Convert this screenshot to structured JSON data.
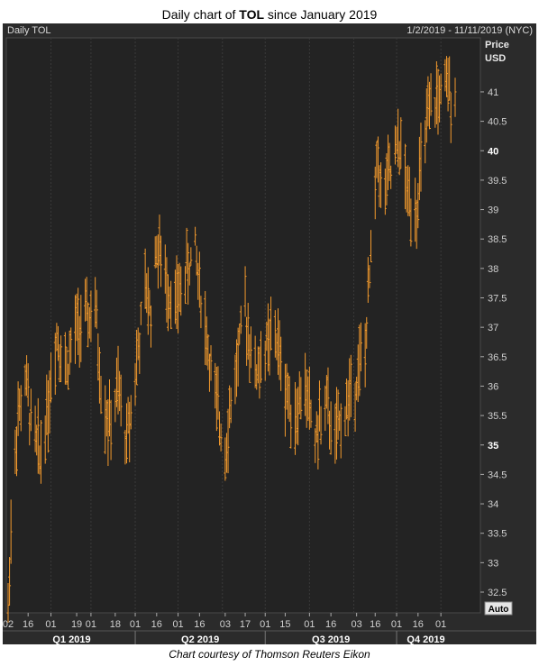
{
  "title": {
    "prefix": "Daily chart of ",
    "ticker": "TOL",
    "suffix": " since January 2019"
  },
  "caption": "Chart courtesy of Thomson Reuters Eikon",
  "chart_data": {
    "type": "ohlc",
    "panel_label": "Daily TOL",
    "date_range": "1/2/2019 - 11/11/2019 (NYC)",
    "ylabel": "Price\nUSD",
    "ylim": [
      32,
      42
    ],
    "yticks": [
      32.5,
      33,
      33.5,
      34,
      34.5,
      35,
      35.5,
      36,
      36.5,
      37,
      37.5,
      38,
      38.5,
      39,
      39.5,
      40,
      40.5,
      41
    ],
    "yticks_bold": [
      35,
      40
    ],
    "auto_label": "Auto",
    "x_day_ticks": [
      "02",
      "16",
      "01",
      "19",
      "01",
      "18",
      "01",
      "16",
      "01",
      "16",
      "03",
      "17",
      "01",
      "15",
      "01",
      "16",
      "03",
      "16",
      "01",
      "16",
      "01"
    ],
    "quarters": [
      "Q1 2019",
      "Q2 2019",
      "Q3 2019",
      "Q4 2019"
    ],
    "bar_color": "#f39a2d",
    "series_points": [
      [
        "2019-01-02",
        32.2
      ],
      [
        "2019-01-04",
        33.6
      ],
      [
        "2019-01-08",
        35.3
      ],
      [
        "2019-01-14",
        36.1
      ],
      [
        "2019-01-18",
        35.4
      ],
      [
        "2019-01-24",
        34.8
      ],
      [
        "2019-01-30",
        35.7
      ],
      [
        "2019-02-05",
        36.9
      ],
      [
        "2019-02-12",
        36.3
      ],
      [
        "2019-02-19",
        37.0
      ],
      [
        "2019-02-26",
        37.1
      ],
      [
        "2019-03-04",
        37.3
      ],
      [
        "2019-03-08",
        36.0
      ],
      [
        "2019-03-14",
        35.3
      ],
      [
        "2019-03-20",
        35.9
      ],
      [
        "2019-03-26",
        35.1
      ],
      [
        "2019-04-01",
        36.2
      ],
      [
        "2019-04-08",
        37.6
      ],
      [
        "2019-04-12",
        37.3
      ],
      [
        "2019-04-16",
        38.4
      ],
      [
        "2019-04-22",
        37.8
      ],
      [
        "2019-04-30",
        37.4
      ],
      [
        "2019-05-06",
        37.9
      ],
      [
        "2019-05-13",
        38.3
      ],
      [
        "2019-05-20",
        37.0
      ],
      [
        "2019-05-28",
        35.6
      ],
      [
        "2019-06-03",
        35.0
      ],
      [
        "2019-06-10",
        36.2
      ],
      [
        "2019-06-17",
        37.3
      ],
      [
        "2019-06-24",
        36.2
      ],
      [
        "2019-07-01",
        36.6
      ],
      [
        "2019-07-08",
        36.9
      ],
      [
        "2019-07-15",
        36.0
      ],
      [
        "2019-07-22",
        35.5
      ],
      [
        "2019-07-29",
        36.0
      ],
      [
        "2019-08-05",
        35.1
      ],
      [
        "2019-08-12",
        35.7
      ],
      [
        "2019-08-19",
        35.1
      ],
      [
        "2019-08-26",
        35.6
      ],
      [
        "2019-09-03",
        36.2
      ],
      [
        "2019-09-09",
        36.6
      ],
      [
        "2019-09-13",
        38.2
      ],
      [
        "2019-09-18",
        40.1
      ],
      [
        "2019-09-20",
        39.2
      ],
      [
        "2019-09-27",
        39.6
      ],
      [
        "2019-10-03",
        40.1
      ],
      [
        "2019-10-09",
        39.2
      ],
      [
        "2019-10-15",
        39.1
      ],
      [
        "2019-10-22",
        40.4
      ],
      [
        "2019-10-29",
        40.9
      ],
      [
        "2019-11-05",
        41.0
      ],
      [
        "2019-11-11",
        41.1
      ]
    ]
  }
}
